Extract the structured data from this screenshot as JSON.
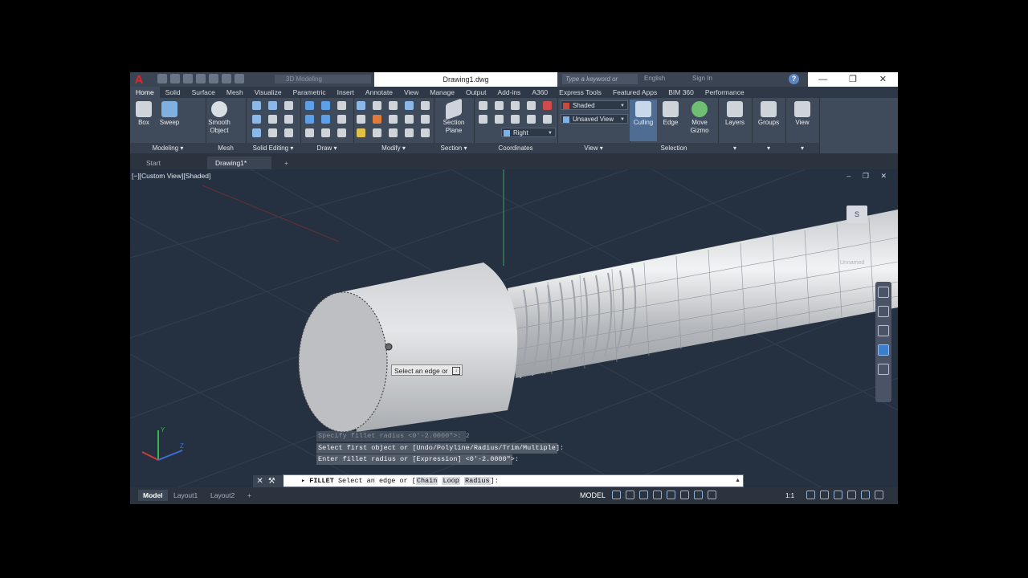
{
  "titlebar": {
    "logo": "A",
    "workspace": "3D Modeling",
    "document_title": "Drawing1.dwg",
    "search_placeholder": "Type a keyword or phrase",
    "language": "English",
    "sign_in": "Sign In",
    "help": "?",
    "minimize": "—",
    "restore": "❐",
    "close": "✕"
  },
  "ribbon_tabs": [
    "Home",
    "Solid",
    "Surface",
    "Mesh",
    "Visualize",
    "Parametric",
    "Insert",
    "Annotate",
    "View",
    "Manage",
    "Output",
    "Add-ins",
    "A360",
    "Express Tools",
    "Featured Apps",
    "BIM 360",
    "Performance"
  ],
  "ribbon": {
    "buttons": {
      "box": "Box",
      "sweep": "Sweep",
      "smooth_object": "Smooth Object",
      "section_plane": "Section Plane",
      "culling": "Culling",
      "edge": "Edge",
      "move_gizmo": "Move Gizmo",
      "layers": "Layers",
      "groups": "Groups",
      "view": "View"
    },
    "combos": {
      "visual_style": "Shaded",
      "named_view": "Unsaved View",
      "ucs": "Right"
    },
    "panels": [
      "Modeling ▾",
      "Mesh",
      "Solid Editing ▾",
      "Draw ▾",
      "Modify ▾",
      "Section ▾",
      "Coordinates",
      "View ▾",
      "Selection"
    ]
  },
  "doc_tabs": [
    "Start",
    "Drawing1*"
  ],
  "viewport": {
    "label": "[−][Custom View][Shaded]",
    "controls": "–  ❐  ✕",
    "tooltip": "Select an edge or",
    "viewcube_label": "Unnamed",
    "viewcube_face": "S"
  },
  "command_history": [
    "Specify fillet radius <0'-2.0000\">: 2",
    "Select first object or [Undo/Polyline/Radius/Trim/Multiple]:",
    "Enter fillet radius or [Expression] <0'-2.0000\">:"
  ],
  "command_line": {
    "command": "FILLET",
    "prompt": "Select an edge or [",
    "options": [
      "Chain",
      "Loop",
      "Radius"
    ],
    "suffix": "]:"
  },
  "status": {
    "layout_tabs": [
      "Model",
      "Layout1",
      "Layout2"
    ],
    "model_button": "MODEL",
    "scale": "1:1"
  }
}
